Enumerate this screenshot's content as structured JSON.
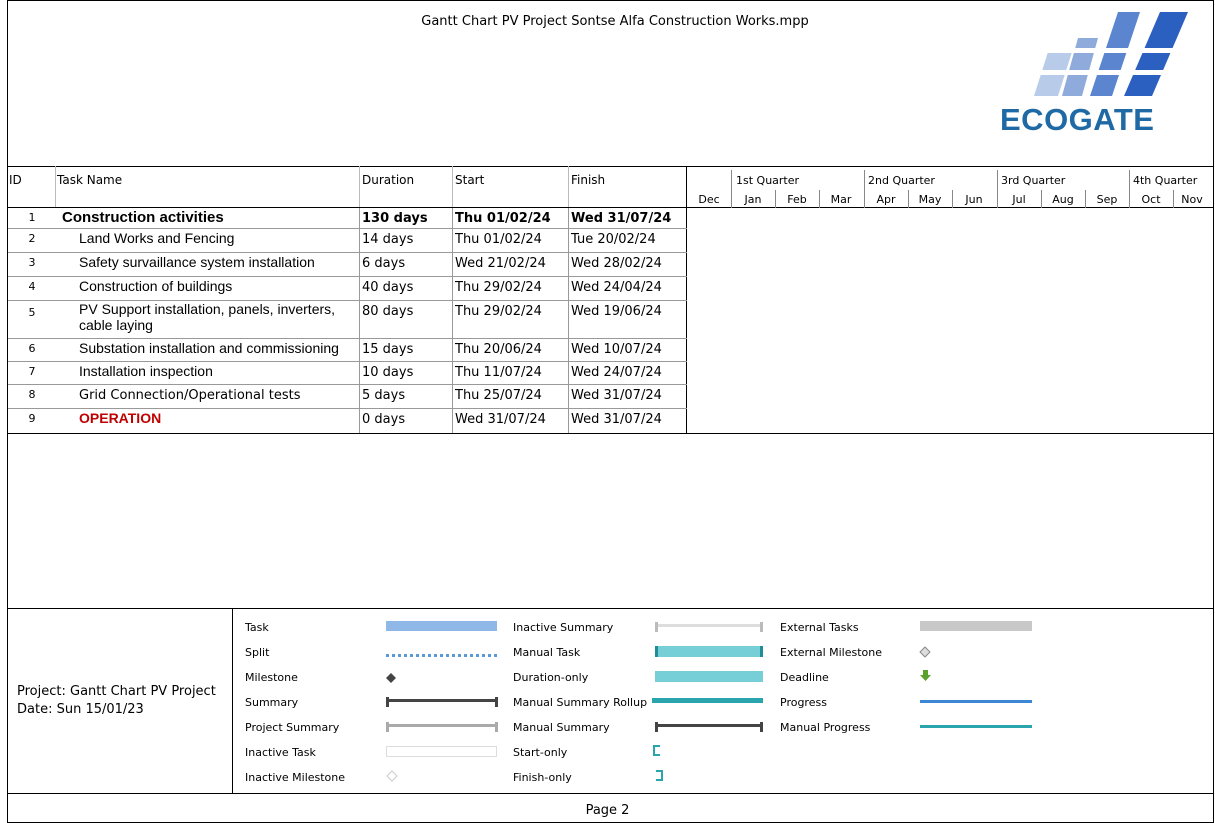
{
  "document": {
    "title": "Gantt Chart PV Project Sontse Alfa Construction Works.mpp",
    "logo_text": "ECOGATE",
    "page_label": "Page 2"
  },
  "table": {
    "headers": {
      "id": "ID",
      "name": "Task Name",
      "duration": "Duration",
      "start": "Start",
      "finish": "Finish"
    },
    "rows": [
      {
        "id": "1",
        "name": "Construction activities",
        "duration": "130 days",
        "start": "Thu 01/02/24",
        "finish": "Wed 31/07/24"
      },
      {
        "id": "2",
        "name": "Land Works and Fencing",
        "duration": "14 days",
        "start": "Thu 01/02/24",
        "finish": "Tue 20/02/24"
      },
      {
        "id": "3",
        "name": "Safety survaillance system installation",
        "duration": "6 days",
        "start": "Wed 21/02/24",
        "finish": "Wed 28/02/24"
      },
      {
        "id": "4",
        "name": "Construction of buildings",
        "duration": "40 days",
        "start": "Thu 29/02/24",
        "finish": "Wed 24/04/24"
      },
      {
        "id": "5",
        "name_line1": "PV Support installation, panels, inverters,",
        "name_line2": "cable laying",
        "duration": "80 days",
        "start": "Thu 29/02/24",
        "finish": "Wed 19/06/24"
      },
      {
        "id": "6",
        "name": "Substation installation and commissioning",
        "duration": "15 days",
        "start": "Thu 20/06/24",
        "finish": "Wed 10/07/24"
      },
      {
        "id": "7",
        "name": "Installation inspection",
        "duration": "10 days",
        "start": "Thu 11/07/24",
        "finish": "Wed 24/07/24"
      },
      {
        "id": "8",
        "name": "Grid Connection/Operational tests",
        "duration": "5 days",
        "start": "Thu 25/07/24",
        "finish": "Wed 31/07/24"
      },
      {
        "id": "9",
        "name": "OPERATION",
        "duration": "0 days",
        "start": "Wed 31/07/24",
        "finish": "Wed 31/07/24"
      }
    ]
  },
  "timeline": {
    "quarters": [
      "1st Quarter",
      "2nd Quarter",
      "3rd Quarter",
      "4th Quarter"
    ],
    "months": [
      "Dec",
      "Jan",
      "Feb",
      "Mar",
      "Apr",
      "May",
      "Jun",
      "Jul",
      "Aug",
      "Sep",
      "Oct",
      "Nov"
    ]
  },
  "footer": {
    "project": "Project: Gantt Chart PV Project",
    "date": "Date: Sun 15/01/23",
    "legend": {
      "col1": [
        "Task",
        "Split",
        "Milestone",
        "Summary",
        "Project Summary",
        "Inactive Task",
        "Inactive Milestone"
      ],
      "col2": [
        "Inactive Summary",
        "Manual Task",
        "Duration-only",
        "Manual Summary Rollup",
        "Manual Summary",
        "Start-only",
        "Finish-only"
      ],
      "col3": [
        "External Tasks",
        "External Milestone",
        "Deadline",
        "Progress",
        "Manual Progress"
      ]
    }
  },
  "colors": {
    "task": "#8fb8e8",
    "manual": "#76cfd6",
    "progress": "#3d86d4",
    "teal": "#2aa4ad",
    "summary": "#444444",
    "external": "#c8c8c8",
    "deadline": "#5aa02c",
    "operation": "#c00000"
  }
}
